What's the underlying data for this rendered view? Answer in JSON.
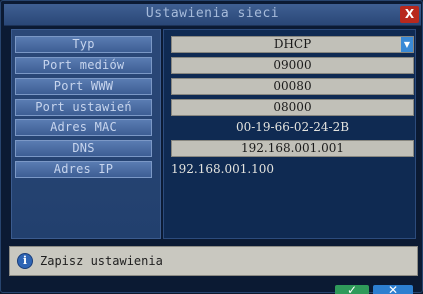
{
  "window": {
    "title": "Ustawienia sieci",
    "close_label": "X"
  },
  "fields": [
    {
      "label": "Typ",
      "value": "DHCP"
    },
    {
      "label": "Port mediów",
      "value": "09000"
    },
    {
      "label": "Port WWW",
      "value": "00080"
    },
    {
      "label": "Port ustawień",
      "value": "08000"
    },
    {
      "label": "Adres MAC",
      "value": "00-19-66-02-24-2B"
    },
    {
      "label": "DNS",
      "value": "192.168.001.001"
    },
    {
      "label": "Adres IP",
      "value": "192.168.001.100"
    }
  ],
  "status": {
    "icon": "info-icon",
    "text": "Zapisz ustawienia"
  },
  "buttons": {
    "ok_icon": "check-icon",
    "cancel_icon": "close-icon"
  },
  "colors": {
    "title_bar": "#2a4777",
    "label_button": "#3d5e94",
    "value_field": "#c1c0b8",
    "close_button": "#b8281d",
    "dropdown_arrow": "#3a8ad6"
  }
}
